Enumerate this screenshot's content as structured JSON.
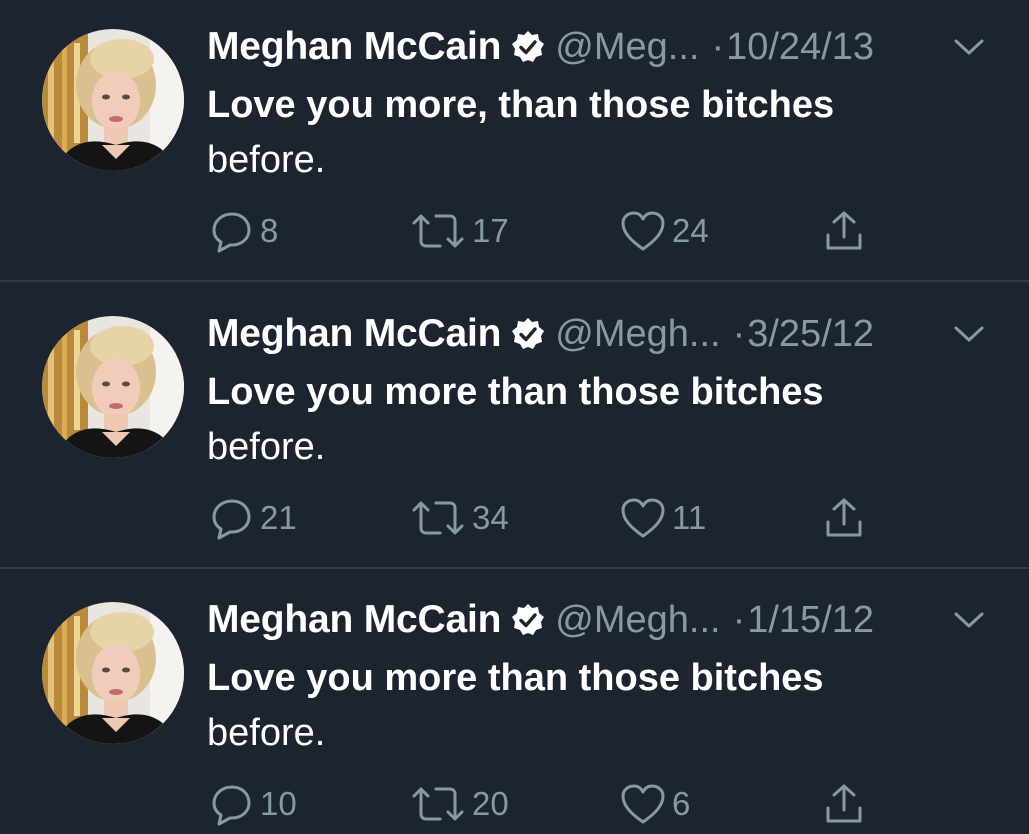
{
  "colors": {
    "background": "#1c2430",
    "divider": "#2f3a46",
    "primary_text": "#ffffff",
    "secondary_text": "#8899a6",
    "verified_badge": "#ffffff"
  },
  "tweets": [
    {
      "author_name": "Meghan McCain",
      "handle": "@Meg...",
      "separator": "·",
      "date": "10/24/13",
      "text_line1": "Love you more, than those bitches",
      "text_line2": "before.",
      "replies": "8",
      "retweets": "17",
      "likes": "24",
      "icons": [
        "reply-icon",
        "retweet-icon",
        "like-icon",
        "share-icon",
        "verified-icon",
        "chevron-down-icon"
      ]
    },
    {
      "author_name": "Meghan McCain",
      "handle": "@Megh...",
      "separator": "·",
      "date": "3/25/12",
      "text_line1": "Love you more than those bitches",
      "text_line2": "before.",
      "replies": "21",
      "retweets": "34",
      "likes": "11",
      "icons": [
        "reply-icon",
        "retweet-icon",
        "like-icon",
        "share-icon",
        "verified-icon",
        "chevron-down-icon"
      ]
    },
    {
      "author_name": "Meghan McCain",
      "handle": "@Megh...",
      "separator": "·",
      "date": "1/15/12",
      "text_line1": "Love you more than those bitches",
      "text_line2": "before.",
      "replies": "10",
      "retweets": "20",
      "likes": "6",
      "icons": [
        "reply-icon",
        "retweet-icon",
        "like-icon",
        "share-icon",
        "verified-icon",
        "chevron-down-icon"
      ]
    }
  ]
}
